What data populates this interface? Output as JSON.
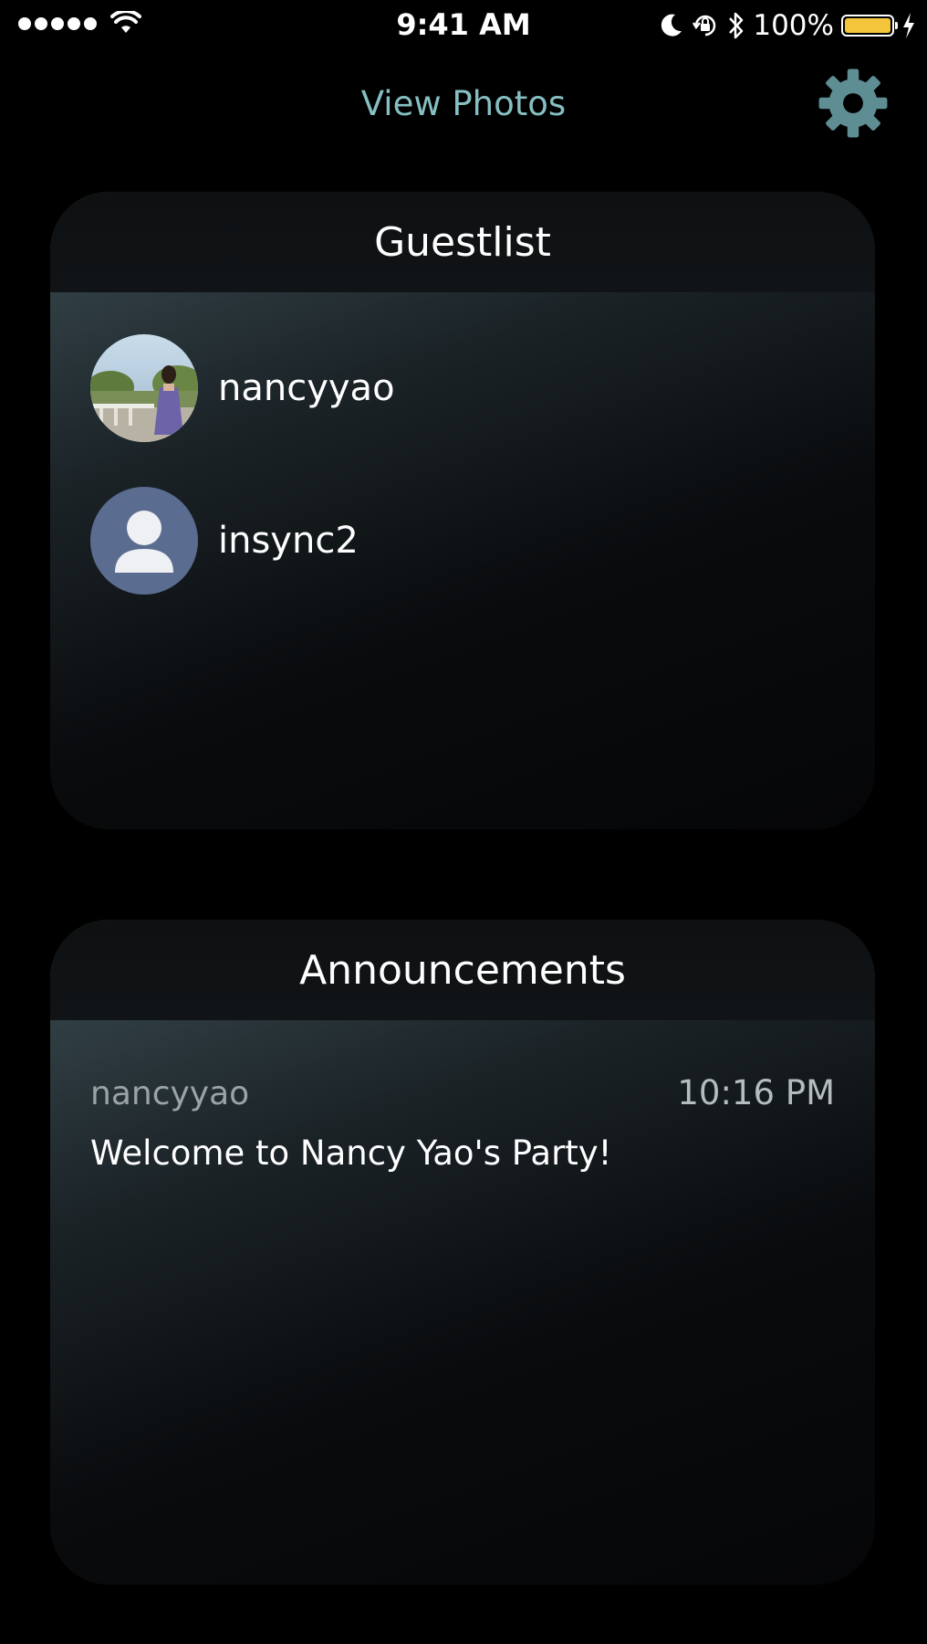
{
  "status_bar": {
    "time": "9:41 AM",
    "battery_percent": "100%",
    "battery_level": 1.0,
    "signal_bars": 5,
    "icons": [
      "signal-dots-icon",
      "wifi-icon",
      "moon-icon",
      "orientation-lock-icon",
      "bluetooth-icon",
      "battery-icon",
      "charging-bolt-icon"
    ]
  },
  "nav": {
    "title": "View Photos",
    "settings_icon": "gear-icon"
  },
  "guestlist": {
    "title": "Guestlist",
    "guests": [
      {
        "name": "nancyyao",
        "avatar": "photo-avatar"
      },
      {
        "name": "insync2",
        "avatar": "default-person-icon"
      }
    ]
  },
  "announcements": {
    "title": "Announcements",
    "items": [
      {
        "author": "nancyyao",
        "time": "10:16 PM",
        "message": "Welcome to Nancy Yao's Party!"
      }
    ]
  },
  "colors": {
    "accent": "#86bfc2",
    "gear": "#5e8d93",
    "battery": "#f4c53b",
    "default_avatar_bg": "#5a6c8f"
  }
}
